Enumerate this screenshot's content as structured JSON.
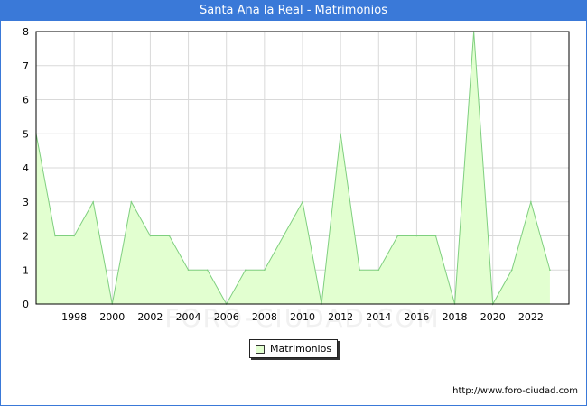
{
  "header": {
    "title": "Santa Ana la Real - Matrimonios"
  },
  "watermark": "FORO-CIUDAD.COM",
  "footer": {
    "url": "http://www.foro-ciudad.com"
  },
  "colors": {
    "title_bar": "#3a79d8",
    "area_fill": "#e2ffd0",
    "area_line": "#7fcf7f",
    "grid": "#d9d9d9"
  },
  "chart_data": {
    "type": "area",
    "title": "Santa Ana la Real - Matrimonios",
    "xlabel": "",
    "ylabel": "",
    "x": [
      1996,
      1997,
      1998,
      1999,
      2000,
      2001,
      2002,
      2003,
      2004,
      2005,
      2006,
      2007,
      2008,
      2009,
      2010,
      2011,
      2012,
      2013,
      2014,
      2015,
      2016,
      2017,
      2018,
      2019,
      2020,
      2021,
      2022,
      2023
    ],
    "series": [
      {
        "name": "Matrimonios",
        "values": [
          5,
          2,
          2,
          3,
          0,
          3,
          2,
          2,
          1,
          1,
          0,
          1,
          1,
          2,
          3,
          0,
          5,
          1,
          1,
          2,
          2,
          2,
          0,
          8,
          0,
          1,
          3,
          1
        ]
      }
    ],
    "xlim": [
      1996,
      2024
    ],
    "ylim": [
      0,
      8
    ],
    "x_ticks": [
      "1998",
      "2000",
      "2002",
      "2004",
      "2006",
      "2008",
      "2010",
      "2012",
      "2014",
      "2016",
      "2018",
      "2020",
      "2022"
    ],
    "y_ticks": [
      "0",
      "1",
      "2",
      "3",
      "4",
      "5",
      "6",
      "7",
      "8"
    ],
    "grid": true,
    "legend": "bottom-center"
  }
}
